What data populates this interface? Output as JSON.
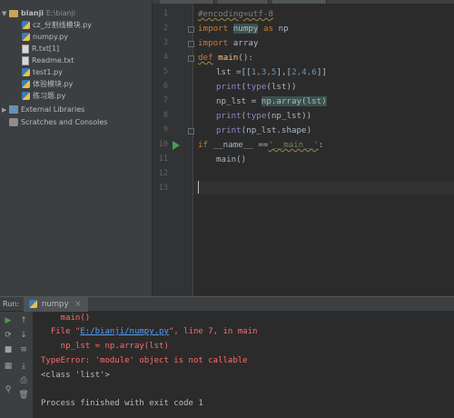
{
  "project": {
    "root_name": "bianji",
    "root_path": "E:\\bianji",
    "files": [
      "cz_分割线模块.py",
      "numpy.py",
      "R.txt[1]",
      "Readme.txt",
      "test1.py",
      "体验模块.py",
      "练习题.py"
    ],
    "external_libraries": "External Libraries",
    "scratches": "Scratches and Consoles"
  },
  "editor": {
    "line_numbers": [
      "1",
      "2",
      "3",
      "4",
      "5",
      "6",
      "7",
      "8",
      "9",
      "10",
      "11",
      "12",
      "13"
    ],
    "code": {
      "l1": "#encoding=utf-8",
      "l2_kw": "import",
      "l2_mod": "numpy",
      "l2_as": "as",
      "l2_alias": "np",
      "l3_kw": "import",
      "l3_mod": "array",
      "l4_kw": "def",
      "l4_fn": "main",
      "l4_rest": "():",
      "l5_a": "lst =[[",
      "l5_n1": "1",
      "l5_c1": ",",
      "l5_n2": "3",
      "l5_c2": ",",
      "l5_n3": "5",
      "l5_b": "],[",
      "l5_n4": "2",
      "l5_c3": ",",
      "l5_n5": "4",
      "l5_c4": ",",
      "l5_n6": "6",
      "l5_e": "]]",
      "l6_bi": "print",
      "l6_p": "(",
      "l6_bi2": "type",
      "l6_r": "(lst))",
      "l7_a": "np_lst = ",
      "l7_hl": "np.array(lst)",
      "l8_bi": "print",
      "l8_p": "(",
      "l8_bi2": "type",
      "l8_r": "(np_lst))",
      "l9_bi": "print",
      "l9_r": "(np_lst.shape)",
      "l10_kw": "if",
      "l10_a": " __name__ ==",
      "l10_str": "'__main__'",
      "l10_e": ":",
      "l11": "main()"
    }
  },
  "run": {
    "label": "Run:",
    "tab_name": "numpy",
    "console": [
      "    main()",
      "  File \"",
      "E:/bianji/numpy.py",
      "\", line 7, in main",
      "    np_lst = np.array(lst)",
      "TypeError: 'module' object is not callable",
      "<class 'list'>",
      "Process finished with exit code 1"
    ]
  },
  "colors": {
    "editor_bg": "#2b2b2b",
    "panel_bg": "#3c3f41",
    "keyword": "#cc7832",
    "error": "#ff6b68",
    "link": "#589df6"
  }
}
